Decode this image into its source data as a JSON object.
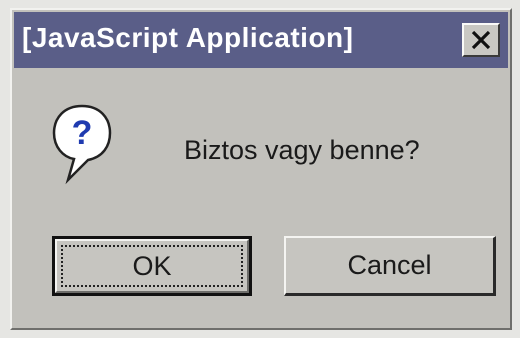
{
  "window": {
    "title": "[JavaScript Application]",
    "close_icon": "close-icon"
  },
  "dialog": {
    "icon": "question-icon",
    "message": "Biztos vagy benne?"
  },
  "buttons": {
    "ok_label": "OK",
    "cancel_label": "Cancel"
  },
  "colors": {
    "titlebar": "#5a5e88",
    "dialog_bg": "#c2c1bc",
    "title_text": "#ffffff"
  }
}
